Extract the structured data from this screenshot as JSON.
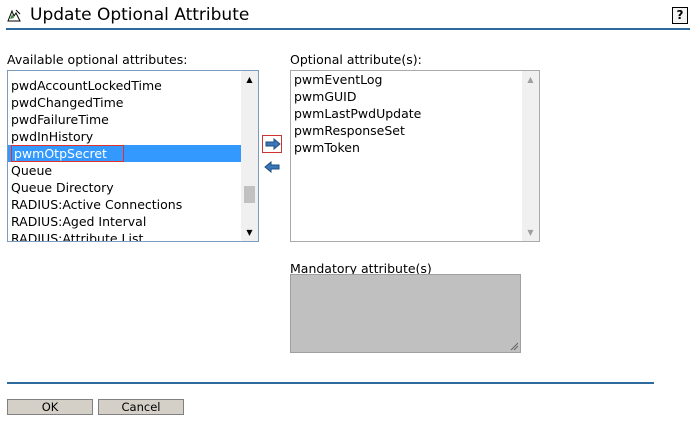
{
  "header": {
    "title": "Update Optional Attribute",
    "help_label": "?"
  },
  "available": {
    "label": "Available optional attributes:",
    "items": [
      "pwdAccountLockedTime",
      "pwdChangedTime",
      "pwdFailureTime",
      "pwdInHistory",
      "pwmOtpSecret",
      "Queue",
      "Queue Directory",
      "RADIUS:Active Connections",
      "RADIUS:Aged Interval",
      "RADIUS:Attribute List"
    ],
    "selected": "pwmOtpSecret"
  },
  "optional": {
    "label": "Optional attribute(s):",
    "items": [
      "pwmEventLog",
      "pwmGUID",
      "pwmLastPwdUpdate",
      "pwmResponseSet",
      "pwmToken"
    ]
  },
  "mandatory": {
    "label": "Mandatory attribute(s)"
  },
  "buttons": {
    "ok": "OK",
    "cancel": "Cancel"
  },
  "colors": {
    "accent": "#2d6b9e",
    "selection": "#3399ff",
    "highlight_border": "#e03030"
  }
}
